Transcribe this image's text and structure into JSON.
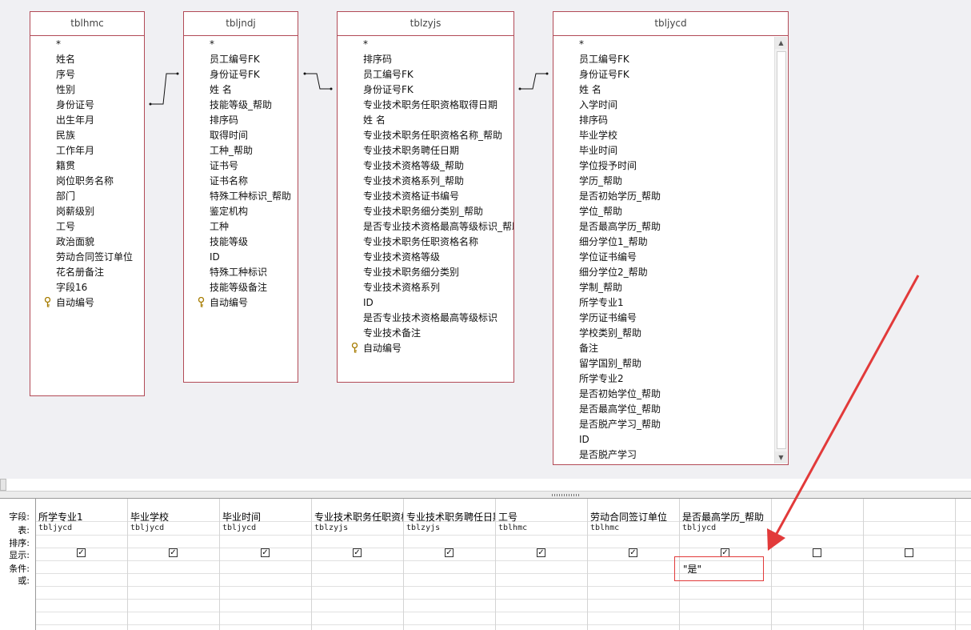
{
  "tables": [
    {
      "name": "tblhmc",
      "fields": [
        "*",
        "姓名",
        "序号",
        "性别",
        "身份证号",
        "出生年月",
        "民族",
        "工作年月",
        "籍贯",
        "岗位职务名称",
        "部门",
        "岗薪级别",
        "工号",
        "政治面貌",
        "劳动合同签订单位",
        "花名册备注",
        "字段16",
        "自动编号"
      ],
      "key_field_index": 17
    },
    {
      "name": "tbljndj",
      "fields": [
        "*",
        "员工编号FK",
        "身份证号FK",
        "姓 名",
        "技能等级_帮助",
        "排序码",
        "取得时间",
        "工种_帮助",
        "证书号",
        "证书名称",
        "特殊工种标识_帮助",
        "鉴定机构",
        "工种",
        "技能等级",
        "ID",
        "特殊工种标识",
        "技能等级备注",
        "自动编号"
      ],
      "key_field_index": 17
    },
    {
      "name": "tblzyjs",
      "fields": [
        "*",
        "排序码",
        "员工编号FK",
        "身份证号FK",
        "专业技术职务任职资格取得日期",
        "姓 名",
        "专业技术职务任职资格名称_帮助",
        "专业技术职务聘任日期",
        "专业技术资格等级_帮助",
        "专业技术资格系列_帮助",
        "专业技术资格证书编号",
        "专业技术职务细分类别_帮助",
        "是否专业技术资格最高等级标识_帮助",
        "专业技术职务任职资格名称",
        "专业技术资格等级",
        "专业技术职务细分类别",
        "专业技术资格系列",
        "ID",
        "是否专业技术资格最高等级标识",
        "专业技术备注",
        "自动编号"
      ],
      "key_field_index": 20
    },
    {
      "name": "tbljycd",
      "fields": [
        "*",
        "员工编号FK",
        "身份证号FK",
        "姓 名",
        "入学时间",
        "排序码",
        "毕业学校",
        "毕业时间",
        "学位授予时间",
        "学历_帮助",
        "是否初始学历_帮助",
        "学位_帮助",
        "是否最高学历_帮助",
        "细分学位1_帮助",
        "学位证书编号",
        "细分学位2_帮助",
        "学制_帮助",
        "所学专业1",
        "学历证书编号",
        "学校类别_帮助",
        "备注",
        "留学国别_帮助",
        "所学专业2",
        "是否初始学位_帮助",
        "是否最高学位_帮助",
        "是否脱产学习_帮助",
        "ID",
        "是否脱产学习"
      ],
      "key_field_index": -1
    }
  ],
  "grid": {
    "row_labels": [
      "字段:",
      "表:",
      "排序:",
      "显示:",
      "条件:",
      "或:"
    ],
    "columns": [
      {
        "field": "所学专业1",
        "table": "tbljycd",
        "show": true,
        "criteria": ""
      },
      {
        "field": "毕业学校",
        "table": "tbljycd",
        "show": true,
        "criteria": ""
      },
      {
        "field": "毕业时间",
        "table": "tbljycd",
        "show": true,
        "criteria": ""
      },
      {
        "field": "专业技术职务任职资格取得日期",
        "table": "tblzyjs",
        "show": true,
        "criteria": ""
      },
      {
        "field": "专业技术职务聘任日期",
        "table": "tblzyjs",
        "show": true,
        "criteria": ""
      },
      {
        "field": "工号",
        "table": "tblhmc",
        "show": true,
        "criteria": ""
      },
      {
        "field": "劳动合同签订单位",
        "table": "tblhmc",
        "show": true,
        "criteria": ""
      },
      {
        "field": "是否最高学历_帮助",
        "table": "tbljycd",
        "show": true,
        "criteria": "\"是\""
      },
      {
        "field": "",
        "table": "",
        "show": false,
        "criteria": ""
      },
      {
        "field": "",
        "table": "",
        "show": false,
        "criteria": ""
      }
    ]
  },
  "colors": {
    "table_border": "#b24a56",
    "annotation": "#e23a3a"
  }
}
